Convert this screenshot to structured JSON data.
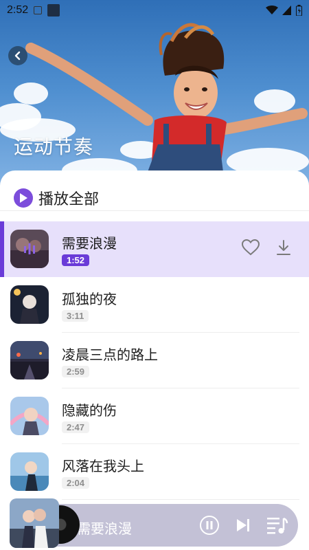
{
  "status_bar": {
    "time": "2:52"
  },
  "hero": {
    "title": "运动节奏"
  },
  "play_all": {
    "label": "播放全部"
  },
  "songs": [
    {
      "title": "需要浪漫",
      "duration": "1:52",
      "active": true
    },
    {
      "title": "孤独的夜",
      "duration": "3:11",
      "active": false
    },
    {
      "title": "凌晨三点的路上",
      "duration": "2:59",
      "active": false
    },
    {
      "title": "隐藏的伤",
      "duration": "2:47",
      "active": false
    },
    {
      "title": "风落在我头上",
      "duration": "2:04",
      "active": false
    }
  ],
  "mini_player": {
    "title": "需要浪漫"
  },
  "colors": {
    "accent": "#6a3bd8",
    "active_row_bg": "#e7e0fb",
    "mini_player_bg": "#c3c1d6"
  },
  "icons": {
    "back": "chevron-left-icon",
    "play_all": "play-icon",
    "like": "heart-icon",
    "download": "download-icon",
    "pause": "pause-icon",
    "next": "skip-next-icon",
    "playlist": "playlist-icon"
  }
}
